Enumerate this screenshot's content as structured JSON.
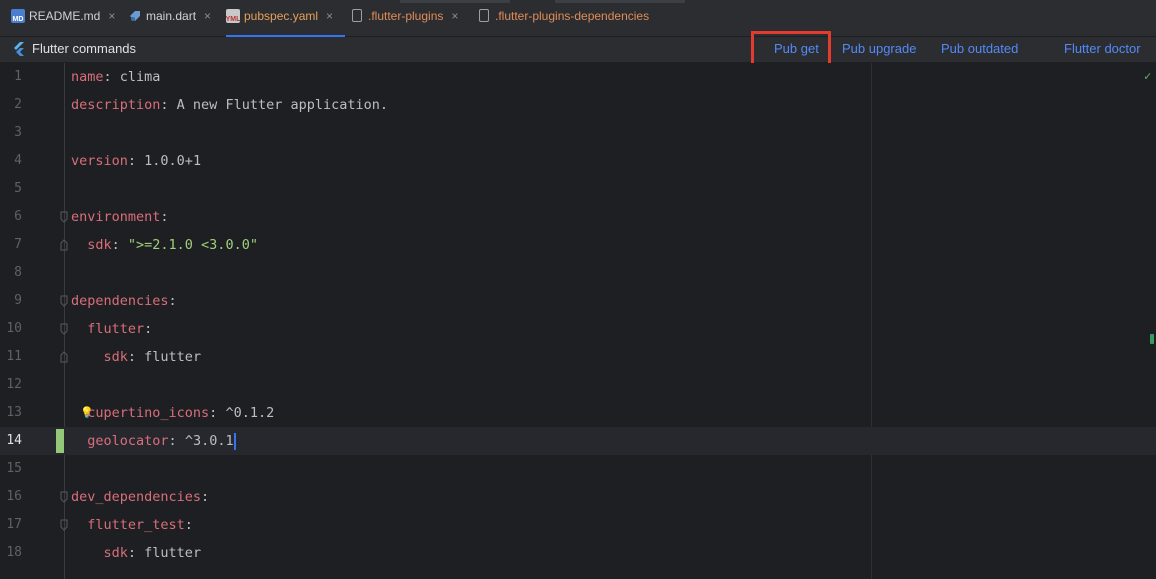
{
  "tabs": [
    {
      "label": "README.md",
      "icon": "markdown-file-icon",
      "badge": "MD",
      "close": "×",
      "state": "normal"
    },
    {
      "label": "main.dart",
      "icon": "dart-file-icon",
      "badge": "",
      "close": "×",
      "state": "normal"
    },
    {
      "label": "pubspec.yaml",
      "icon": "yaml-file-icon",
      "badge": "YML",
      "close": "×",
      "state": "active"
    },
    {
      "label": ".flutter-plugins",
      "icon": "text-file-icon",
      "badge": "",
      "close": "×",
      "state": "modified"
    },
    {
      "label": ".flutter-plugins-dependencies",
      "icon": "text-file-icon",
      "badge": "",
      "close": "",
      "state": "modified"
    }
  ],
  "command_bar": {
    "title": "Flutter commands",
    "pub_get": "Pub get",
    "pub_upgrade": "Pub upgrade",
    "pub_outdated": "Pub outdated",
    "flutter_doctor": "Flutter doctor"
  },
  "editor": {
    "lines": [
      {
        "n": "1",
        "key": "name",
        "sep": ": ",
        "val": "clima",
        "kind": "plain"
      },
      {
        "n": "2",
        "key": "description",
        "sep": ": ",
        "val": "A new Flutter application.",
        "kind": "plain"
      },
      {
        "n": "3",
        "key": "",
        "sep": "",
        "val": "",
        "kind": "empty"
      },
      {
        "n": "4",
        "key": "version",
        "sep": ": ",
        "val": "1.0.0+1",
        "kind": "plain"
      },
      {
        "n": "5",
        "key": "",
        "sep": "",
        "val": "",
        "kind": "empty"
      },
      {
        "n": "6",
        "key": "environment",
        "sep": ":",
        "val": "",
        "kind": "plain"
      },
      {
        "n": "7",
        "key": "  sdk",
        "sep": ": ",
        "val": "\">=2.1.0 <3.0.0\"",
        "kind": "string"
      },
      {
        "n": "8",
        "key": "",
        "sep": "",
        "val": "",
        "kind": "empty"
      },
      {
        "n": "9",
        "key": "dependencies",
        "sep": ":",
        "val": "",
        "kind": "plain"
      },
      {
        "n": "10",
        "key": "  flutter",
        "sep": ":",
        "val": "",
        "kind": "plain"
      },
      {
        "n": "11",
        "key": "    sdk",
        "sep": ": ",
        "val": "flutter",
        "kind": "plain"
      },
      {
        "n": "12",
        "key": "",
        "sep": "",
        "val": "",
        "kind": "empty"
      },
      {
        "n": "13",
        "key": "  cupertino_icons",
        "sep": ": ",
        "val": "^0.1.2",
        "kind": "plain"
      },
      {
        "n": "14",
        "key": "  geolocator",
        "sep": ": ",
        "val": "^3.0.1",
        "kind": "plain"
      },
      {
        "n": "15",
        "key": "",
        "sep": "",
        "val": "",
        "kind": "empty"
      },
      {
        "n": "16",
        "key": "dev_dependencies",
        "sep": ":",
        "val": "",
        "kind": "plain"
      },
      {
        "n": "17",
        "key": "  flutter_test",
        "sep": ":",
        "val": "",
        "kind": "plain"
      },
      {
        "n": "18",
        "key": "    sdk",
        "sep": ": ",
        "val": "flutter",
        "kind": "plain"
      }
    ],
    "current_line": "14"
  },
  "colors": {
    "accent": "#3574f0",
    "link": "#548af7",
    "yaml_key": "#d96e7b",
    "string": "#9fd07a",
    "highlight_box": "#e33b2e"
  }
}
